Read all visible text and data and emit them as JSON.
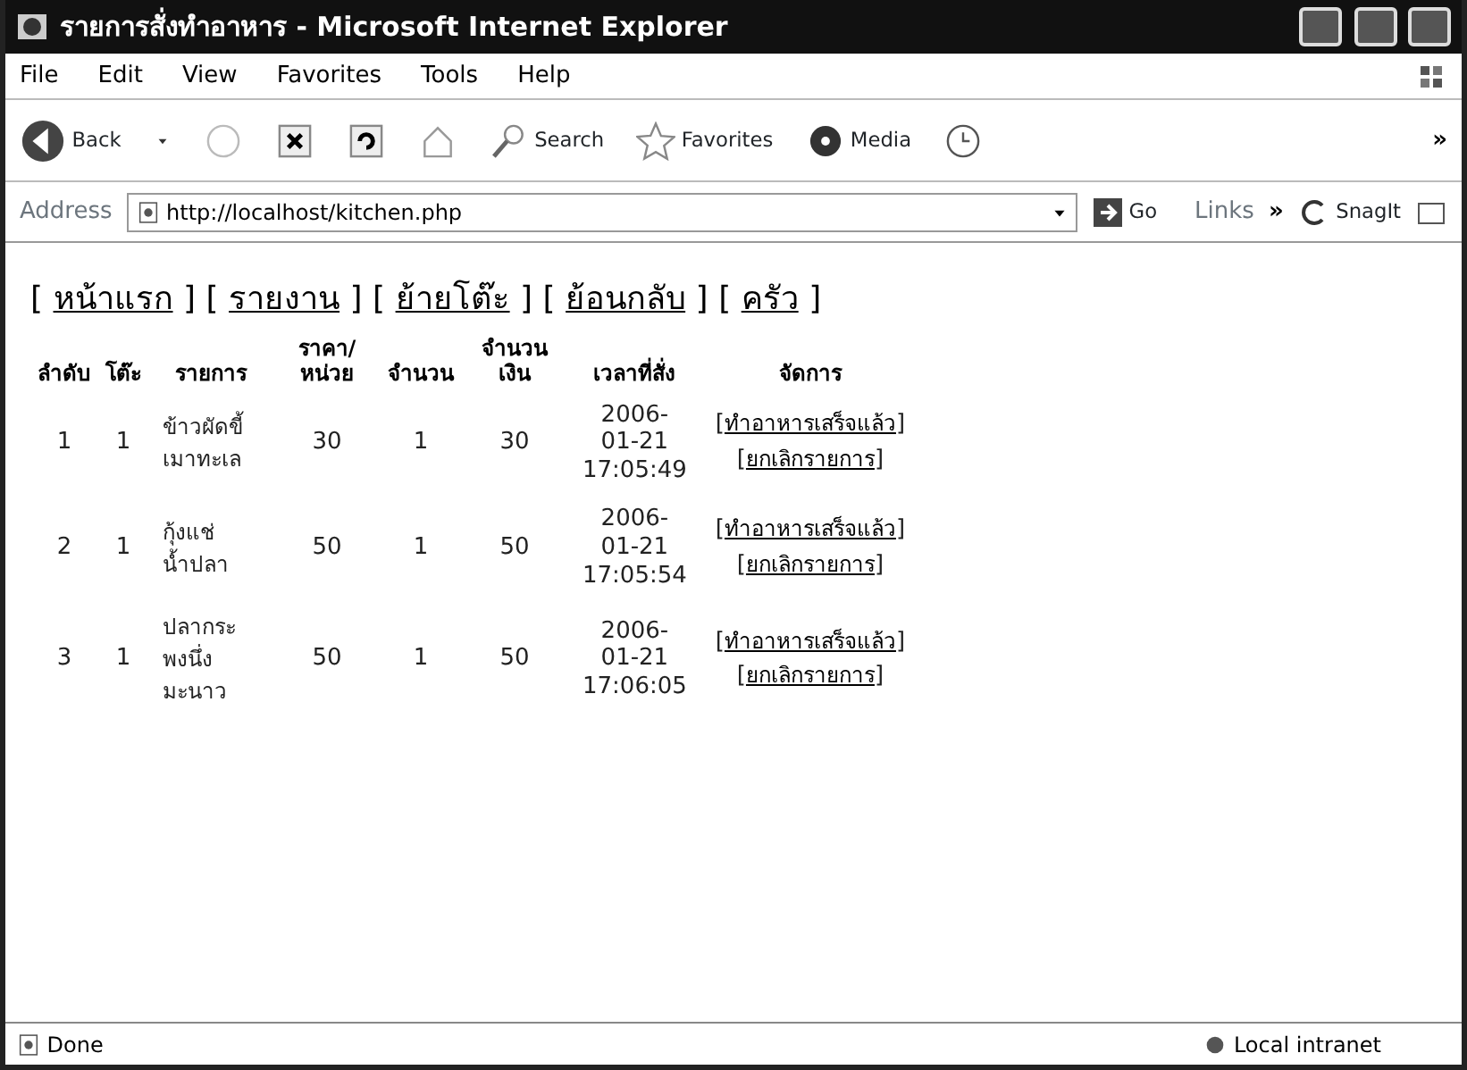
{
  "window": {
    "title": "รายการสั่งทำอาหาร - Microsoft Internet Explorer"
  },
  "menu": [
    "File",
    "Edit",
    "View",
    "Favorites",
    "Tools",
    "Help"
  ],
  "toolbar": {
    "back": "Back",
    "search": "Search",
    "favorites": "Favorites",
    "media": "Media",
    "overflow": "»"
  },
  "address_bar": {
    "label": "Address",
    "value": "http://localhost/kitchen.php",
    "go": "Go",
    "links": "Links",
    "links_more": "»",
    "snagit": "SnagIt"
  },
  "nav_links": [
    {
      "open": "[",
      "label": "หน้าแรก",
      "close": "]"
    },
    {
      "open": "[",
      "label": "รายงาน",
      "close": "]"
    },
    {
      "open": "[",
      "label": "ย้ายโต๊ะ",
      "close": "]"
    },
    {
      "open": "[",
      "label": "ย้อนกลับ",
      "close": "]"
    },
    {
      "open": "[",
      "label": "ครัว",
      "close": "]"
    }
  ],
  "table": {
    "columns": [
      "ลำดับ",
      "โต๊ะ",
      "รายการ",
      "ราคา/ หน่วย",
      "จำนวน",
      "จำนวน เงิน",
      "เวลาที่สั่ง",
      "จัดการ"
    ],
    "rows": [
      {
        "no": "1",
        "table_no": "1",
        "item": "ข้าวผัดขี้เมาทะเล",
        "price": "30",
        "qty": "1",
        "amount": "30",
        "time": "2006-01-21 17:05:49",
        "actions": [
          {
            "open": "[",
            "label": "ทำอาหารเสร็จแล้ว",
            "close": "]"
          },
          {
            "open": "[",
            "label": "ยกเลิกรายการ",
            "close": "]"
          }
        ]
      },
      {
        "no": "2",
        "table_no": "1",
        "item": "กุ้งแช่น้ำปลา",
        "price": "50",
        "qty": "1",
        "amount": "50",
        "time": "2006-01-21 17:05:54",
        "actions": [
          {
            "open": "[",
            "label": "ทำอาหารเสร็จแล้ว",
            "close": "]"
          },
          {
            "open": "[",
            "label": "ยกเลิกรายการ",
            "close": "]"
          }
        ]
      },
      {
        "no": "3",
        "table_no": "1",
        "item": "ปลากระพงนึ่งมะนาว",
        "price": "50",
        "qty": "1",
        "amount": "50",
        "time": "2006-01-21 17:06:05",
        "actions": [
          {
            "open": "[",
            "label": "ทำอาหารเสร็จแล้ว",
            "close": "]"
          },
          {
            "open": "[",
            "label": "ยกเลิกรายการ",
            "close": "]"
          }
        ]
      }
    ]
  },
  "status_bar": {
    "status": "Done",
    "zone": "Local intranet"
  }
}
